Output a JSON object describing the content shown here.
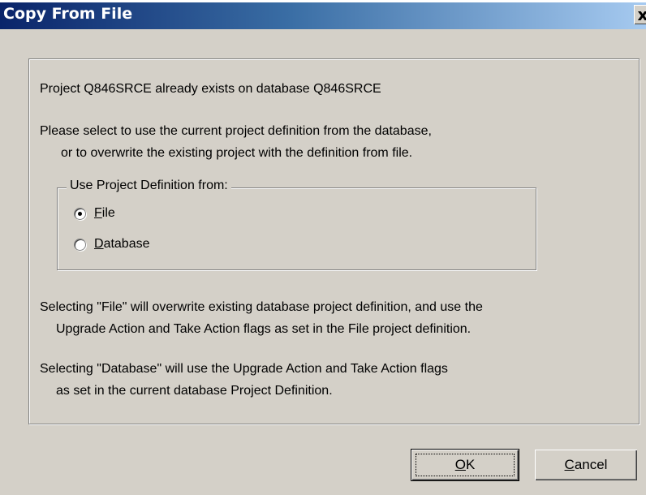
{
  "window": {
    "title": "Copy From File",
    "close_glyph": "x"
  },
  "message": {
    "line1": "Project Q846SRCE already exists on database Q846SRCE",
    "line2a": "Please select to use the current project definition from the database,",
    "line2b": "or to overwrite the existing project with the definition from file."
  },
  "group": {
    "legend": "Use Project Definition from:",
    "options": [
      {
        "mnemonic": "F",
        "rest": "ile",
        "selected": true
      },
      {
        "mnemonic": "D",
        "rest": "atabase",
        "selected": false
      }
    ]
  },
  "notes": {
    "file_a": "Selecting \"File\" will overwrite existing database project definition, and use the",
    "file_b": "Upgrade Action and Take Action flags as set in the File project definition.",
    "db_a": "Selecting \"Database\" will use the Upgrade Action and Take Action flags",
    "db_b": "as set in the current database Project Definition."
  },
  "buttons": {
    "ok": {
      "mnemonic": "O",
      "rest": "K"
    },
    "cancel": {
      "mnemonic": "C",
      "rest": "ancel"
    }
  }
}
